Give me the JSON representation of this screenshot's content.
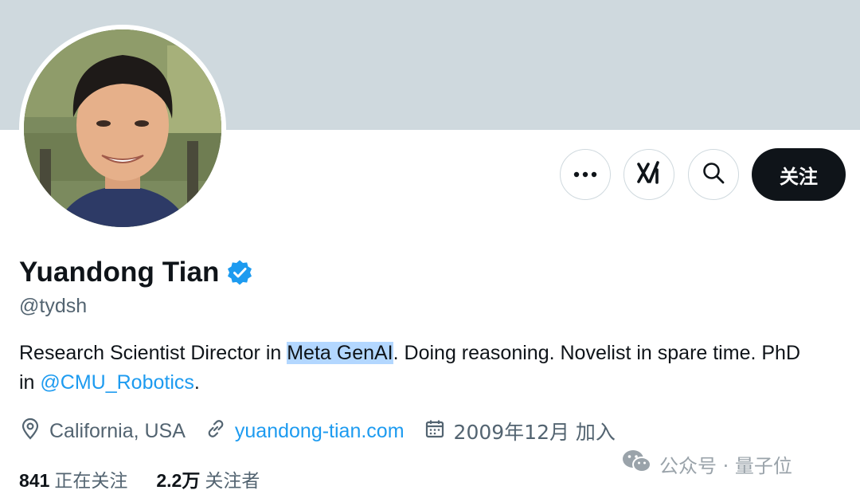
{
  "profile": {
    "display_name": "Yuandong Tian",
    "handle": "@tydsh",
    "bio": {
      "before": "Research Scientist Director in ",
      "highlight": "Meta GenAI",
      "middle": ". Doing reasoning. Novelist in spare time. PhD in ",
      "mention": "@CMU_Robotics",
      "after": "."
    },
    "location": "California, USA",
    "website": "yuandong-tian.com",
    "joined": "2009年12月 加入",
    "following_count": "841",
    "following_label": "正在关注",
    "followers_count": "2.2万",
    "followers_label": "关注者"
  },
  "actions": {
    "follow_label": "关注",
    "more_icon": "more-icon",
    "grok_icon": "grok-icon",
    "search_icon": "search-icon"
  },
  "watermark": {
    "text": "公众号 · 量子位",
    "icon": "wechat-icon"
  },
  "colors": {
    "banner": "#cfd9de",
    "accent": "#1d9bf0",
    "text_primary": "#0f1419",
    "text_secondary": "#536471",
    "highlight": "#b3d7ff",
    "follow_bg": "#0f1419"
  }
}
